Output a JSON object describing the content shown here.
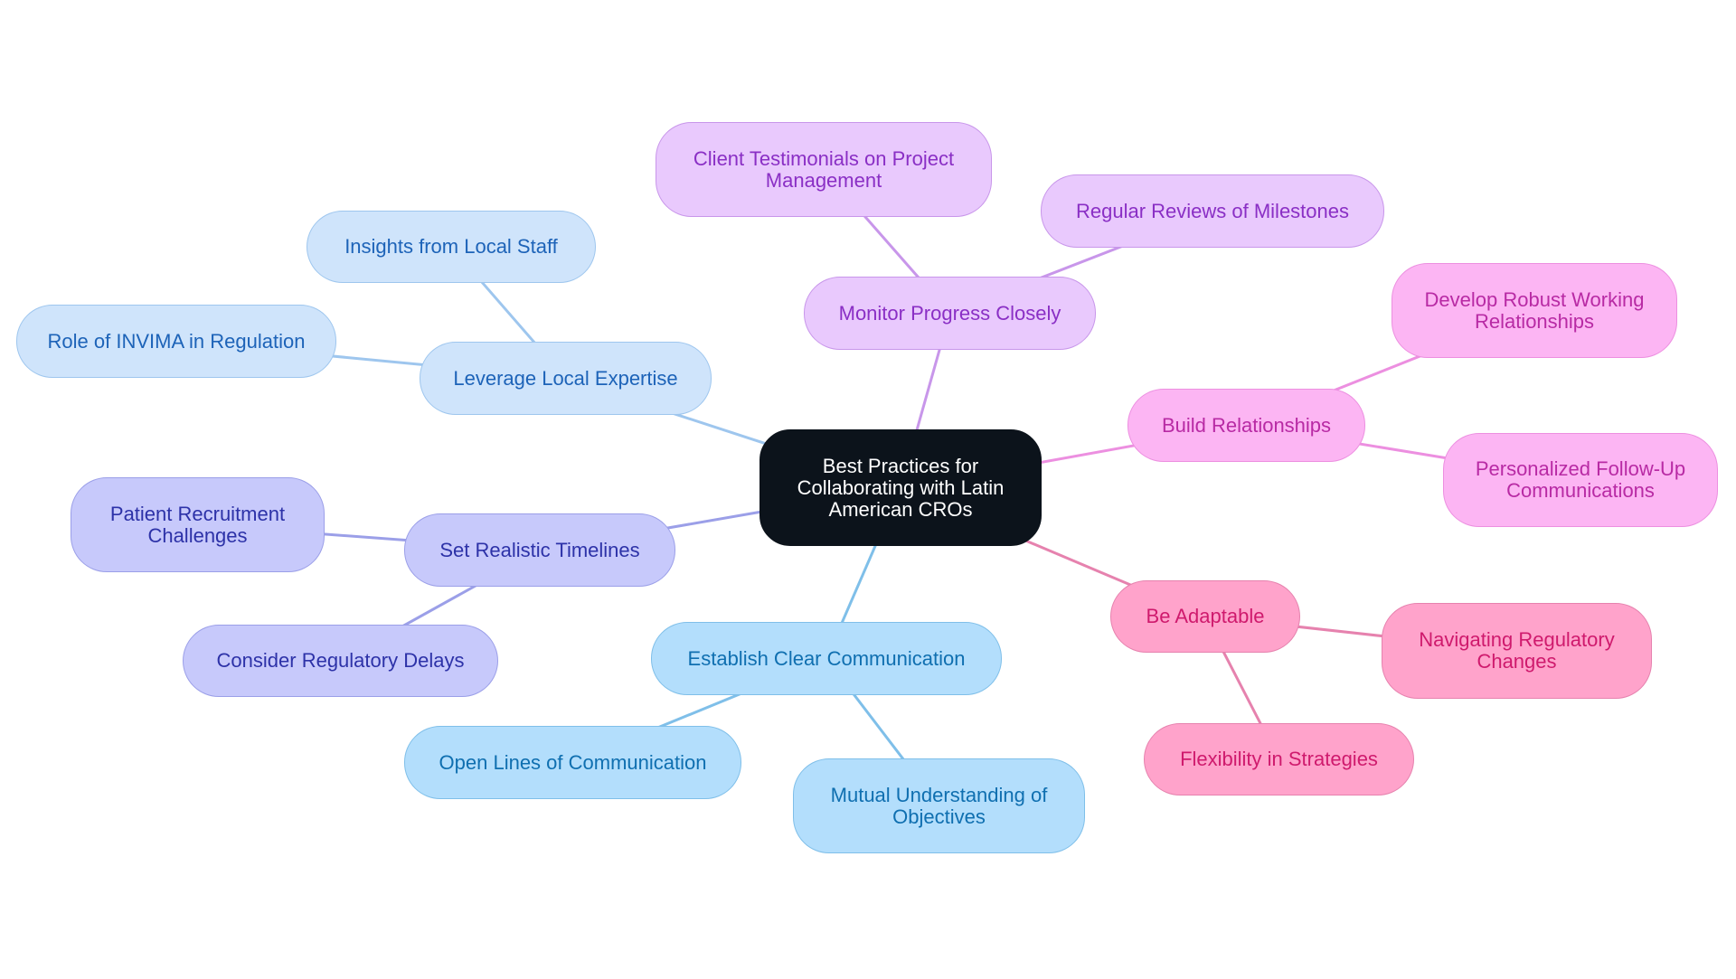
{
  "root": {
    "label": "Best Practices for Collaborating with Latin American CROs"
  },
  "branches": [
    {
      "id": "leverage",
      "label": "Leverage Local Expertise",
      "edge_color": "#9ec6ee",
      "children": [
        {
          "id": "insights",
          "label": "Insights from Local Staff"
        },
        {
          "id": "invima",
          "label": "Role of INVIMA in Regulation"
        }
      ]
    },
    {
      "id": "timelines",
      "label": "Set Realistic Timelines",
      "edge_color": "#9b9fe8",
      "children": [
        {
          "id": "recruitment",
          "label": "Patient Recruitment Challenges"
        },
        {
          "id": "delays",
          "label": "Consider Regulatory Delays"
        }
      ]
    },
    {
      "id": "communication",
      "label": "Establish Clear Communication",
      "edge_color": "#7fbfe9",
      "children": [
        {
          "id": "openlines",
          "label": "Open Lines of Communication"
        },
        {
          "id": "mutual",
          "label": "Mutual Understanding of Objectives"
        }
      ]
    },
    {
      "id": "monitor",
      "label": "Monitor Progress Closely",
      "edge_color": "#c896ea",
      "children": [
        {
          "id": "testimonials",
          "label": "Client Testimonials on Project Management"
        },
        {
          "id": "reviews",
          "label": "Regular Reviews of Milestones"
        }
      ]
    },
    {
      "id": "relationships",
      "label": "Build Relationships",
      "edge_color": "#ec8fe0",
      "children": [
        {
          "id": "robust",
          "label": "Develop Robust Working Relationships"
        },
        {
          "id": "followup",
          "label": "Personalized Follow-Up Communications"
        }
      ]
    },
    {
      "id": "adaptable",
      "label": "Be Adaptable",
      "edge_color": "#e682ae",
      "children": [
        {
          "id": "navigating",
          "label": "Navigating Regulatory Changes"
        },
        {
          "id": "flexibility",
          "label": "Flexibility in Strategies"
        }
      ]
    }
  ]
}
